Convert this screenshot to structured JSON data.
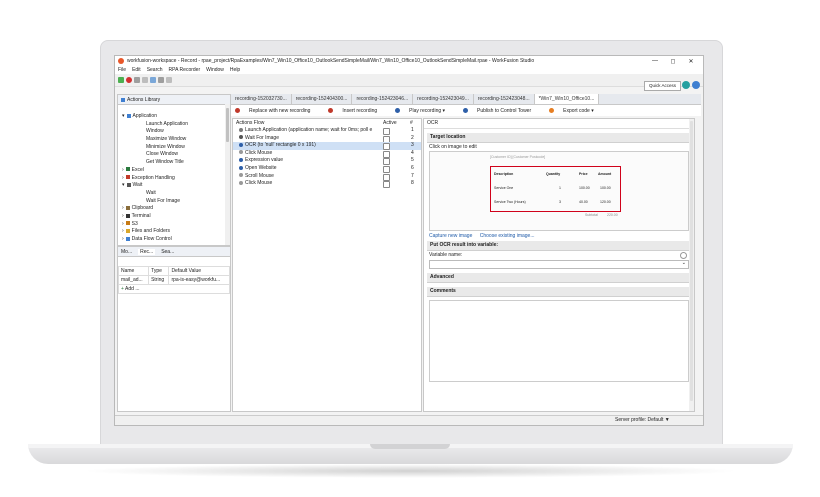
{
  "window": {
    "title": "workfusion-workspace - Record - rpae_project/RpaExamples/Win7_Win10_Office10_OutlookSendSimpleMail/Win7_Win10_Office10_OutlookSendSimpleMail.rpae - WorkFusion Studio",
    "controls": [
      "—",
      "◻",
      "✕"
    ]
  },
  "menu": [
    "File",
    "Edit",
    "Search",
    "RPA Recorder",
    "Window",
    "Help"
  ],
  "quick_access": "Quick Access",
  "actions_library": {
    "tab_label": "Actions Library",
    "items": [
      {
        "label": "Application",
        "level": 1,
        "expand": "▾",
        "color": "#3f7fd1"
      },
      {
        "label": "Launch Application",
        "level": 2
      },
      {
        "label": "Window",
        "level": 2
      },
      {
        "label": "Maximize Window",
        "level": 2
      },
      {
        "label": "Minimize Window",
        "level": 2
      },
      {
        "label": "Close Window",
        "level": 2
      },
      {
        "label": "Get Window Title",
        "level": 2
      },
      {
        "label": "Excel",
        "level": 1,
        "expand": "›",
        "color": "#2a7a3d"
      },
      {
        "label": "Exception Handling",
        "level": 1,
        "expand": "›",
        "color": "#c23b2a"
      },
      {
        "label": "Wait",
        "level": 1,
        "expand": "▾",
        "color": "#555555"
      },
      {
        "label": "Wait",
        "level": 2
      },
      {
        "label": "Wait For Image",
        "level": 2
      },
      {
        "label": "Clipboard",
        "level": 1,
        "expand": "›",
        "color": "#8a6d3b"
      },
      {
        "label": "Terminal",
        "level": 1,
        "expand": "›",
        "color": "#333333"
      },
      {
        "label": "S3",
        "level": 1,
        "expand": "›",
        "color": "#c77b15"
      },
      {
        "label": "Files and Folders",
        "level": 1,
        "expand": "›",
        "color": "#d9a72b"
      },
      {
        "label": "Data Flow Control",
        "level": 1,
        "expand": "›",
        "color": "#3f7fd1"
      }
    ]
  },
  "variables_panel": {
    "tabs": [
      "Mo...",
      "Rec...",
      "Sea..."
    ],
    "columns": [
      "Name",
      "Type",
      "Default Value"
    ],
    "rows": [
      {
        "name": "mail_ad...",
        "type": "String",
        "default": "rpa-is-easy@workfu..."
      }
    ],
    "add_label": "Add ..."
  },
  "editor_tabs": [
    "recording-152032730...",
    "recording-152404300...",
    "recording-152423046...",
    "recording-152423049...",
    "recording-152423048...",
    "*Win7_Win10_Office10..."
  ],
  "editor_toolbar": [
    {
      "label": "Replace with new recording",
      "color": "#c0392b"
    },
    {
      "label": "Insert recording",
      "color": "#c0392b"
    },
    {
      "label": "Play recording ▾",
      "color": "#2e5fa8"
    },
    {
      "label": "Publish to Control Tower",
      "color": "#2e5fa8"
    },
    {
      "label": "Export code ▾",
      "color": "#e67e22"
    }
  ],
  "actions_flow": {
    "header": "Actions Flow",
    "col_active": "Active",
    "col_num": "#",
    "rows": [
      {
        "label": "Launch Application (application name; wait for 0ms; poll e",
        "num": "1",
        "icon": "#7a7a7a"
      },
      {
        "label": "Wait For Image",
        "num": "2",
        "icon": "#555555"
      },
      {
        "label": "OCR (to 'null' rectangle 0 x 191)",
        "num": "3",
        "icon": "#2e5fa8",
        "selected": true
      },
      {
        "label": "Click Mouse",
        "num": "4",
        "icon": "#999999"
      },
      {
        "label": "Expression value",
        "num": "5",
        "icon": "#2e5fa8"
      },
      {
        "label": "Open Website",
        "num": "6",
        "icon": "#2e5fa8"
      },
      {
        "label": "Scroll Mouse",
        "num": "7",
        "icon": "#999999"
      },
      {
        "label": "Click Mouse",
        "num": "8",
        "icon": "#999999"
      }
    ]
  },
  "ocr_panel": {
    "title": "OCR",
    "target_location": "Target location",
    "click_hint": "Click on image to edit",
    "preview_header": "[Customer ID] [Customer Postcode]",
    "preview_table": {
      "columns": [
        "Description",
        "Quantity",
        "Price",
        "Amount"
      ],
      "rows": [
        [
          "Service One",
          "1",
          "100.00",
          "100.00"
        ],
        [
          "Service Two (Hours)",
          "3",
          "40.00",
          "120.00"
        ]
      ],
      "subtotal_label": "Subtotal",
      "subtotal": "220.00"
    },
    "capture_link": "Capture new image",
    "choose_link": "Choose existing image...",
    "put_result": "Put OCR result into variable:",
    "variable_label": "Variable name:",
    "advanced": "Advanced",
    "comments": "Comments"
  },
  "status": {
    "server_profile": "Server profile: Default ▼"
  }
}
